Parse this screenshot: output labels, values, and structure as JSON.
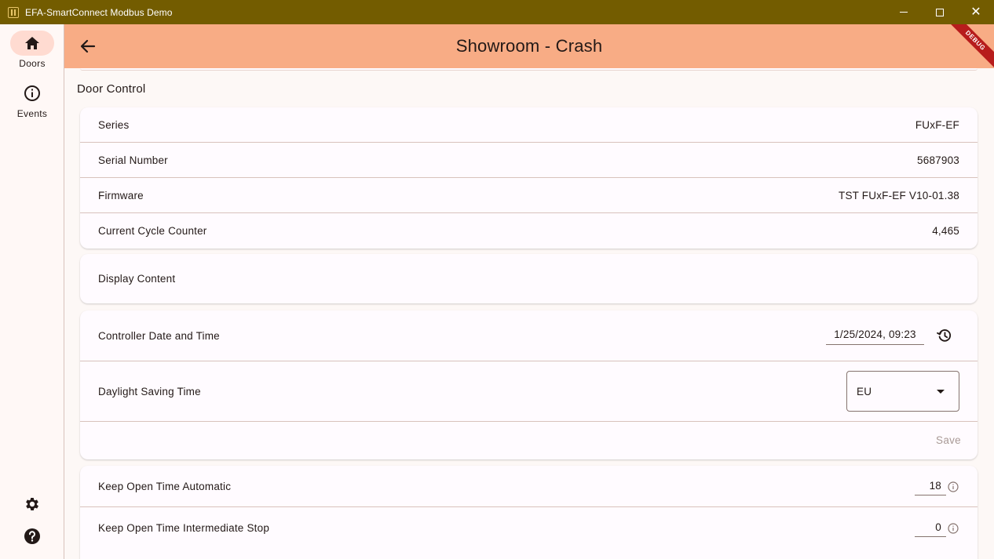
{
  "window": {
    "title": "EFA-SmartConnect Modbus Demo",
    "app_icon": "door-icon",
    "controls": [
      "minimize-icon",
      "maximize-icon",
      "close-icon"
    ],
    "close_glyph": "✕"
  },
  "nav_rail": {
    "items": [
      {
        "label": "Doors",
        "icon": "home-icon",
        "active": true
      },
      {
        "label": "Events",
        "icon": "info-icon",
        "active": false
      }
    ],
    "bottom": [
      {
        "icon": "gear-icon"
      },
      {
        "icon": "help-icon"
      }
    ]
  },
  "appbar": {
    "title": "Showroom - Crash",
    "back_icon": "arrow-back-icon",
    "debug_banner": "DEBUG",
    "background": "#f8ac85"
  },
  "door_control": {
    "title": "Door Control",
    "info_rows": [
      {
        "label": "Series",
        "value": "FUxF-EF"
      },
      {
        "label": "Serial Number",
        "value": "5687903"
      },
      {
        "label": "Firmware",
        "value": "TST FUxF-EF V10-01.38"
      },
      {
        "label": "Current Cycle Counter",
        "value": "4,465"
      }
    ],
    "display_content": {
      "label": "Display Content"
    },
    "datetime": {
      "label": "Controller Date and Time",
      "value": "1/25/2024, 09:23",
      "icon": "history-icon"
    },
    "dst": {
      "label": "Daylight Saving Time",
      "selected": "EU",
      "icon": "dropdown-arrow-icon"
    },
    "save_label": "Save",
    "timing_rows": [
      {
        "label": "Keep Open Time Automatic",
        "value": "18",
        "icon": "info-icon"
      },
      {
        "label": "Keep Open Time Intermediate Stop",
        "value": "0",
        "icon": "info-icon"
      }
    ]
  },
  "colors": {
    "titlebar": "#735c00",
    "appbar": "#f8ac85",
    "rail_active": "#ffdbd1",
    "background": "#fdf8f6",
    "divider": "#d8c2bc",
    "disabled_text": "#a99a96"
  }
}
